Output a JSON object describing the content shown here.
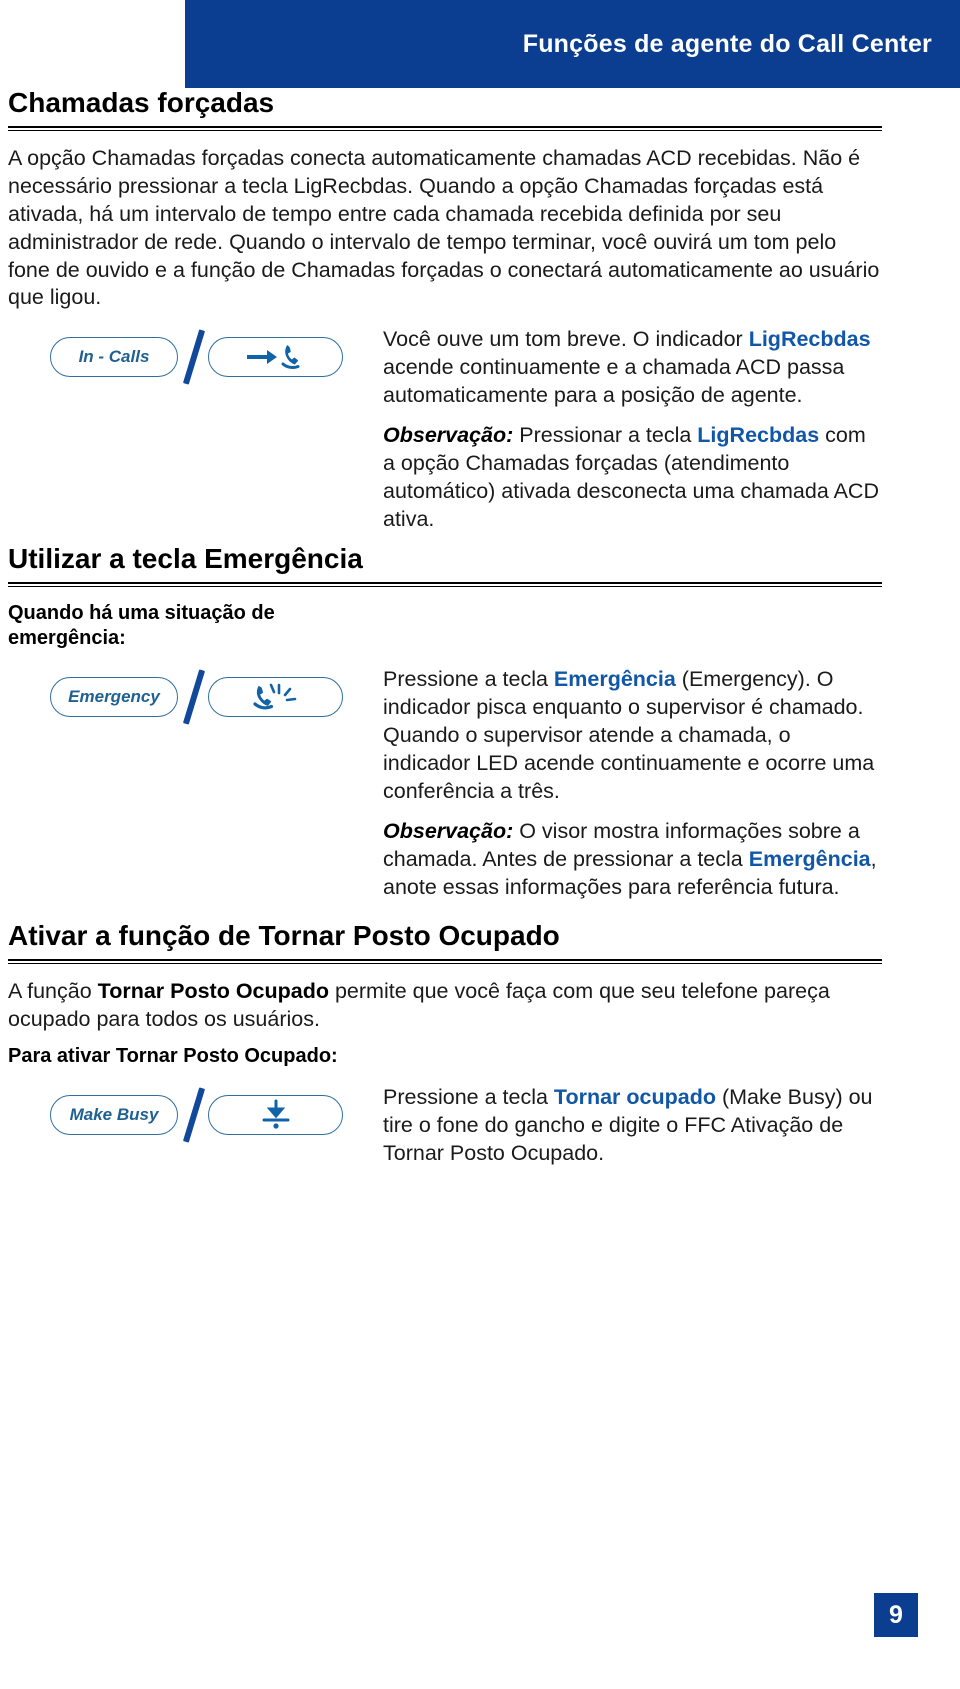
{
  "header": {
    "title": "Funções de agente do Call Center",
    "banner_color": "#0b3d91"
  },
  "accent_colors": {
    "banner_blue": "#0b3d91",
    "link_blue": "#1157a8",
    "key_outline_blue": "#2f6f9e",
    "slash_blue": "#11489b"
  },
  "sections": [
    {
      "heading": "Chamadas forçadas",
      "intro": {
        "part1": "A opção Chamadas forçadas conecta automaticamente chamadas ACD recebidas. Não é necessário pressionar a tecla LigRecbdas. Quando a opção Chamadas forçadas está ativada, há um intervalo de tempo entre cada chamada recebida definida por seu administrador de rede. Quando o intervalo de tempo terminar, você ouvirá um tom pelo fone de ouvido e a função de Chamadas forçadas o conectará automaticamente ao usuário que ligou."
      },
      "key_row": {
        "key_label": "In - Calls",
        "separator": "/",
        "icon_name": "arrow-handset-icon",
        "paragraphs": {
          "p1_a": "Você ouve um tom breve. O indicador ",
          "p1_blue": "LigRecbdas",
          "p1_b": " acende continuamente e a chamada ACD passa automaticamente para a posição de agente.",
          "p2_note": "Observação:",
          "p2_a": " Pressionar a tecla ",
          "p2_blue": "LigRecbdas",
          "p2_b": " com a opção Chamadas forçadas (atendimento automático) ativada desconecta uma chamada ACD ativa."
        }
      }
    },
    {
      "heading": "Utilizar a tecla Emergência",
      "lead_in": "Quando há uma situação de emergência:",
      "key_row": {
        "key_label": "Emergency",
        "separator": "/",
        "icon_name": "ringing-handset-icon",
        "paragraphs": {
          "p1_a": "Pressione a tecla ",
          "p1_blue": "Emergência",
          "p1_b": " (Emergency). O indicador pisca enquanto o supervisor é chamado. Quando o supervisor atende a chamada, o  indicador LED acende continuamente e ocorre uma conferência a três.",
          "p2_note": "Observação:",
          "p2_a": " O visor mostra informações sobre a chamada. Antes de pressionar a tecla ",
          "p2_blue": "Emergência",
          "p2_b": ", anote essas informações para referência futura."
        }
      }
    },
    {
      "heading": "Ativar a função de Tornar Posto Ocupado",
      "intro": {
        "part_a": "A função ",
        "part_bold": "Tornar Posto Ocupado",
        "part_b": " permite que você faça com que seu telefone pareça ocupado para todos os usuários."
      },
      "lead_in": "Para ativar Tornar Posto Ocupado:",
      "key_row": {
        "key_label": "Make Busy",
        "separator": "/",
        "icon_name": "down-arrow-line-icon",
        "paragraphs": {
          "p1_a": "Pressione a tecla ",
          "p1_blue": "Tornar ocupado",
          "p1_b": " (Make Busy) ou tire o fone do gancho e digite o FFC Ativação de Tornar Posto Ocupado."
        }
      }
    }
  ],
  "footer": {
    "page_number": "9"
  }
}
